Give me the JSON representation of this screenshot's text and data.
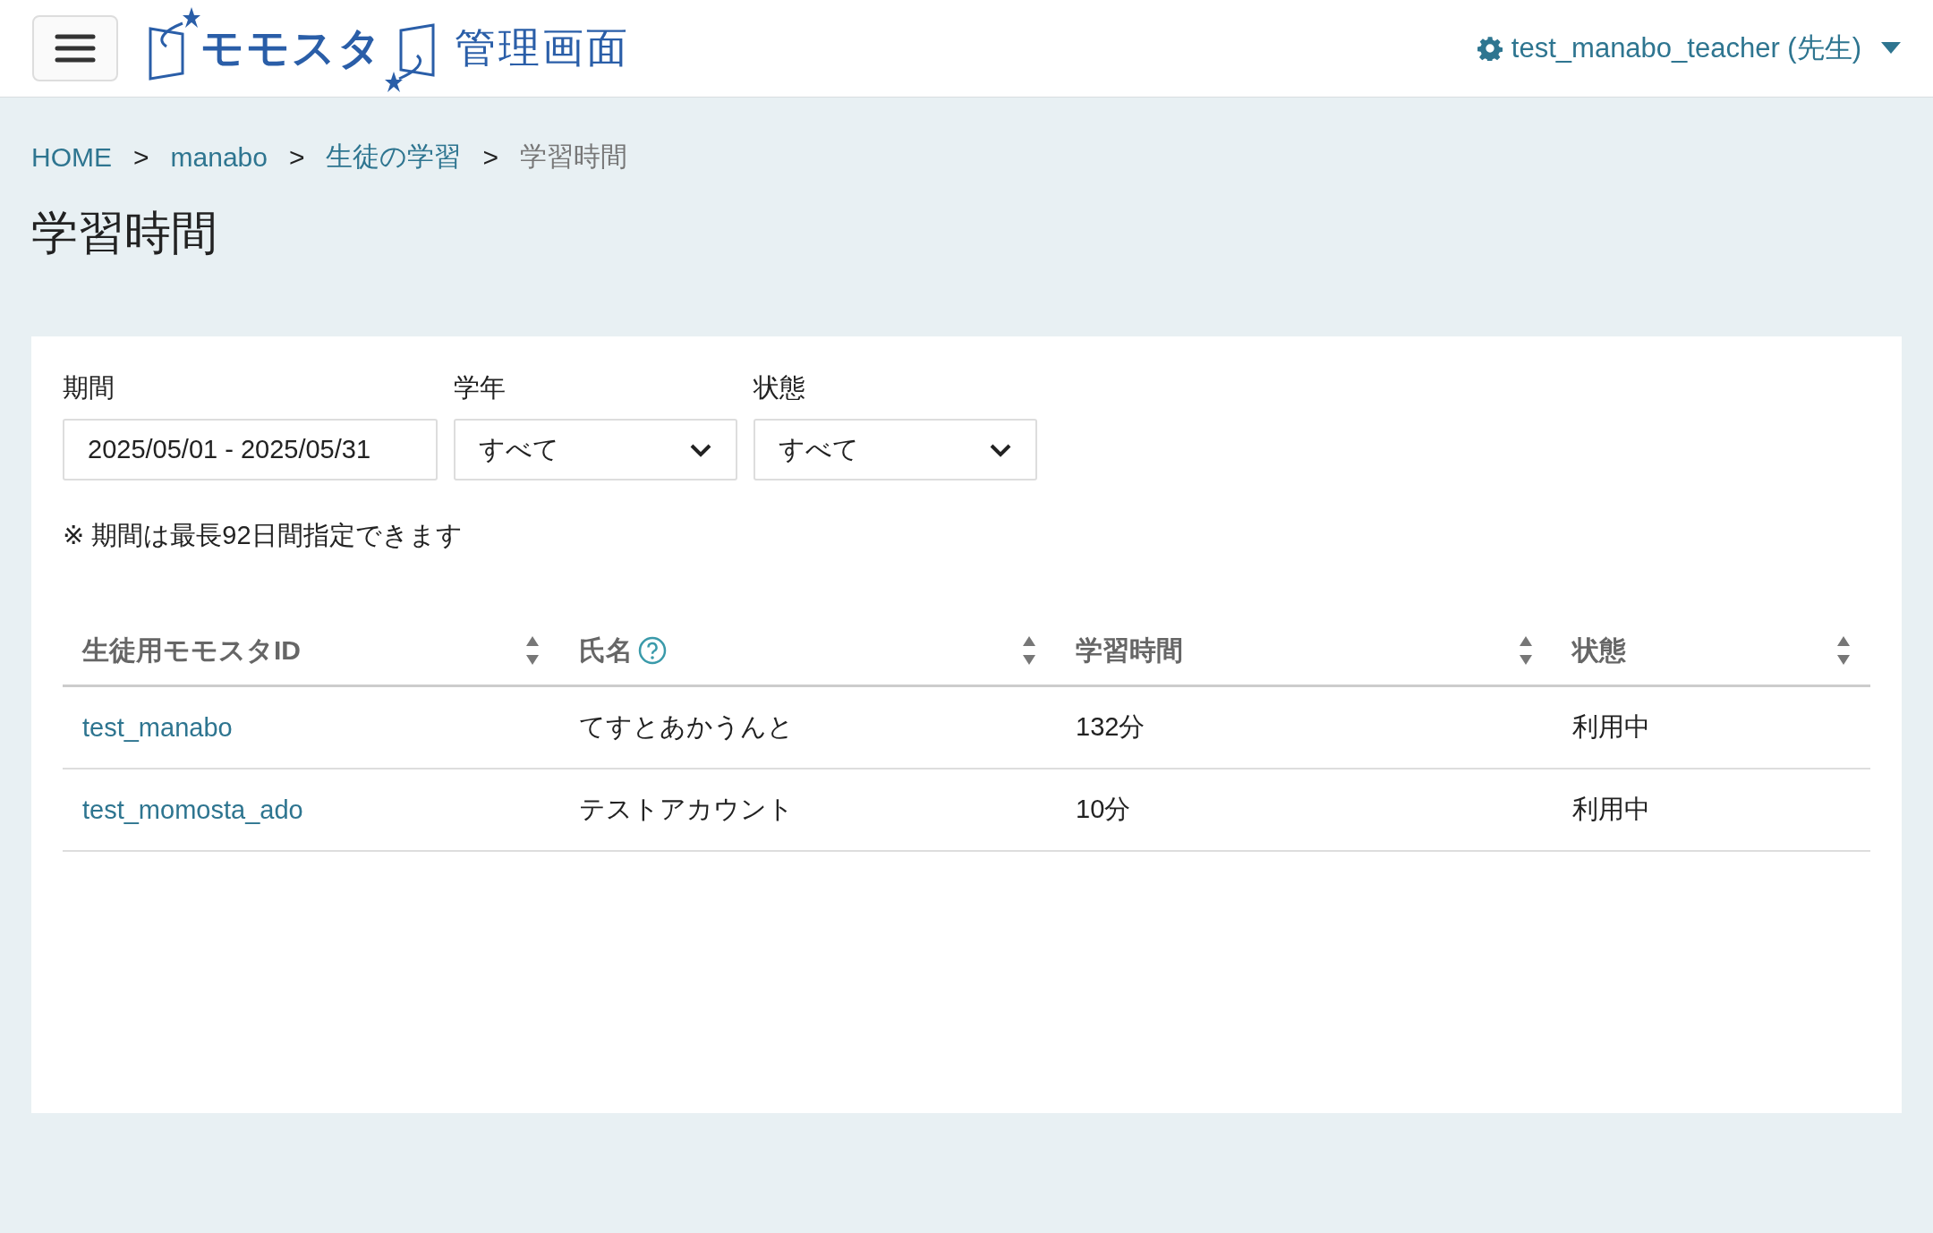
{
  "header": {
    "logo_text": "モモスタ",
    "title": "管理画面",
    "user": "test_manabo_teacher (先生)"
  },
  "breadcrumb": [
    {
      "label": "HOME",
      "link": true
    },
    {
      "label": "manabo",
      "link": true,
      "separator": ">"
    },
    {
      "label": "生徒の学習",
      "link": true,
      "separator": ">"
    },
    {
      "label": "学習時間",
      "link": false,
      "separator": ">"
    }
  ],
  "page_title": "学習時間",
  "filters": [
    {
      "label": "期間",
      "kind": "text",
      "value": "2025/05/01 - 2025/05/31"
    },
    {
      "label": "学年",
      "kind": "select",
      "value": "すべて"
    },
    {
      "label": "状態",
      "kind": "select",
      "value": "すべて"
    }
  ],
  "note": "※ 期間は最長92日間指定できます",
  "table": {
    "columns": [
      {
        "label": "生徒用モモスタID",
        "help": false,
        "link": true
      },
      {
        "label": "氏名",
        "help": true,
        "link": false
      },
      {
        "label": "学習時間",
        "help": false,
        "link": false
      },
      {
        "label": "状態",
        "help": false,
        "link": false
      }
    ],
    "rows": [
      {
        "cells": [
          "test_manabo",
          "てすとあかうんと",
          "132分",
          "利用中"
        ]
      },
      {
        "cells": [
          "test_momosta_ado",
          "テストアカウント",
          "10分",
          "利用中"
        ]
      }
    ]
  }
}
